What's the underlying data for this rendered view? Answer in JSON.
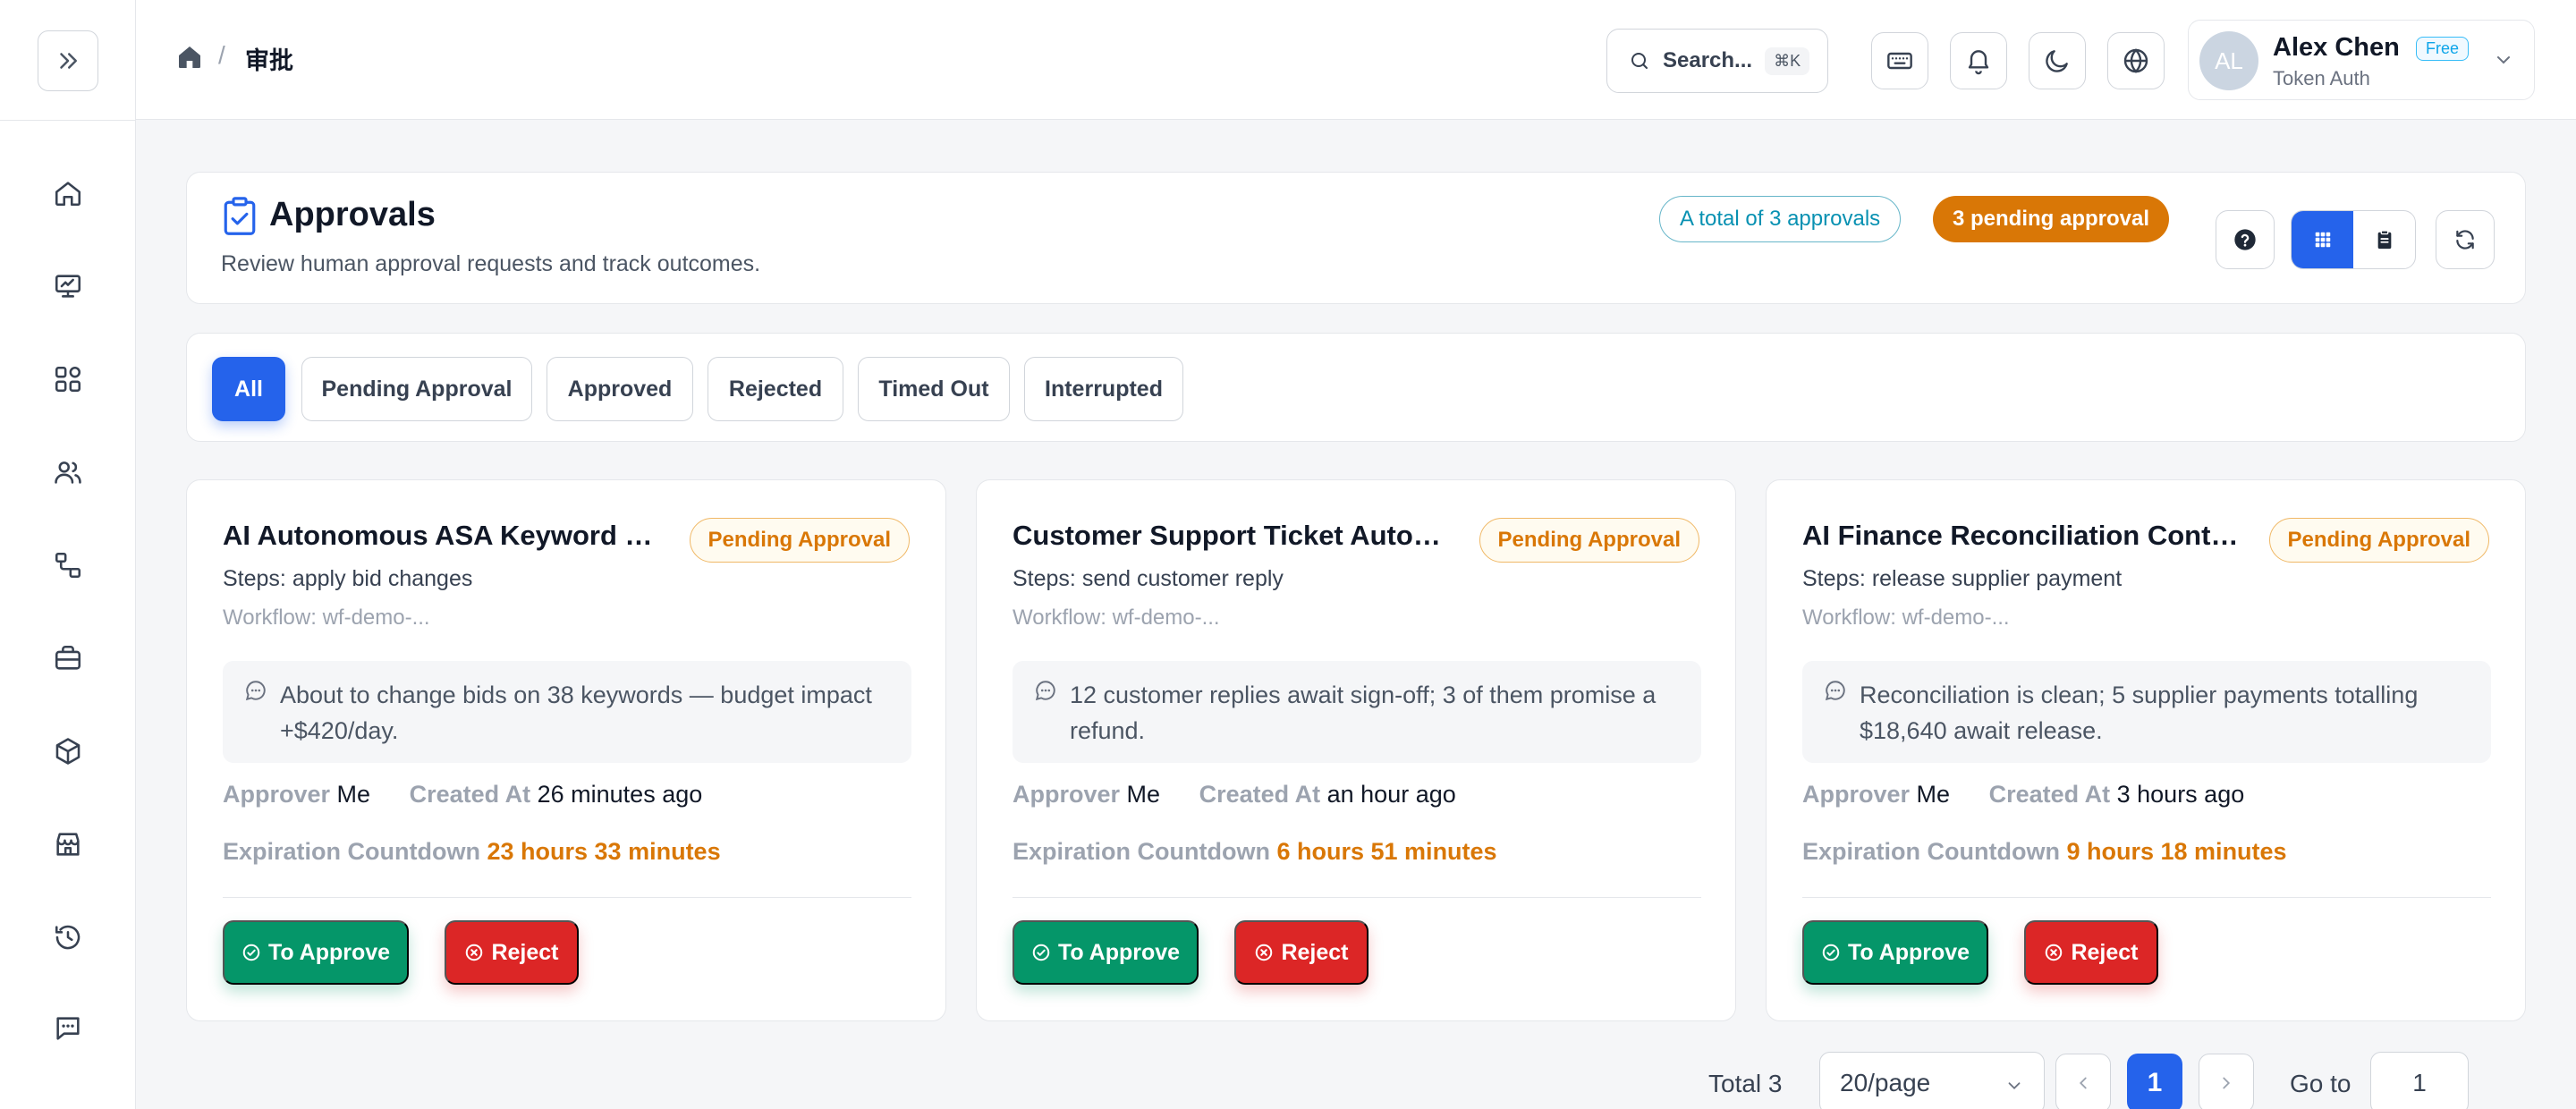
{
  "breadcrumb": {
    "current": "审批",
    "separator": "/"
  },
  "header": {
    "search_label": "Search...",
    "search_shortcut": "⌘K",
    "user": {
      "initials": "AL",
      "name": "Alex Chen",
      "plan": "Free",
      "auth": "Token Auth"
    }
  },
  "page": {
    "title": "Approvals",
    "subtitle": "Review human approval requests and track outcomes.",
    "total_pill": "A total of 3 approvals",
    "pending_pill": "3 pending approval"
  },
  "filters": [
    {
      "label": "All",
      "active": true
    },
    {
      "label": "Pending Approval",
      "active": false
    },
    {
      "label": "Approved",
      "active": false
    },
    {
      "label": "Rejected",
      "active": false
    },
    {
      "label": "Timed Out",
      "active": false
    },
    {
      "label": "Interrupted",
      "active": false
    }
  ],
  "labels": {
    "approver": "Approver",
    "created_at": "Created At",
    "expiration": "Expiration Countdown",
    "approve": "To Approve",
    "reject": "Reject"
  },
  "cards": [
    {
      "title": "AI Autonomous ASA Keyword O...",
      "status": "Pending Approval",
      "steps": "Steps: apply bid changes",
      "workflow": "Workflow: wf-demo-...",
      "summary": "About to change bids on 38 keywords — budget impact +$420/day.",
      "approver": "Me",
      "created": "26 minutes ago",
      "expires": "23 hours 33 minutes"
    },
    {
      "title": "Customer Support Ticket Autom...",
      "status": "Pending Approval",
      "steps": "Steps: send customer reply",
      "workflow": "Workflow: wf-demo-...",
      "summary": "12 customer replies await sign-off; 3 of them promise a refund.",
      "approver": "Me",
      "created": "an hour ago",
      "expires": "6 hours 51 minutes"
    },
    {
      "title": "AI Finance Reconciliation Contro...",
      "status": "Pending Approval",
      "steps": "Steps: release supplier payment",
      "workflow": "Workflow: wf-demo-...",
      "summary": "Reconciliation is clean; 5 supplier payments totalling $18,640 await release.",
      "approver": "Me",
      "created": "3 hours ago",
      "expires": "9 hours 18 minutes"
    }
  ],
  "pagination": {
    "total": "Total 3",
    "page_size": "20/page",
    "current_page": "1",
    "goto_label": "Go to",
    "goto_value": "1"
  },
  "colors": {
    "primary": "#2563eb",
    "success": "#059669",
    "danger": "#dc2626",
    "warning": "#d97706",
    "info": "#0891b2"
  }
}
